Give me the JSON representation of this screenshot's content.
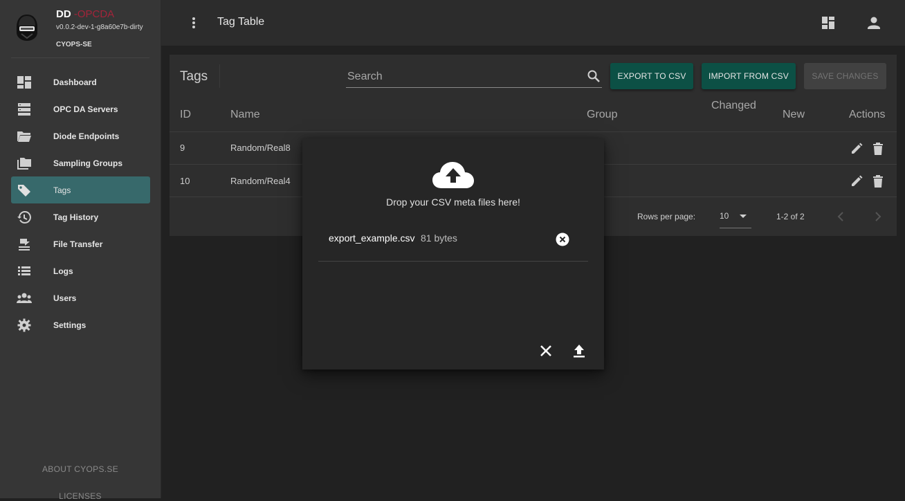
{
  "app": {
    "name": "DD",
    "name_accent": "-OPCDA",
    "version": "v0.0.2-dev-1-g8a60e7b-dirty",
    "org": "CYOPS-SE"
  },
  "sidebar": {
    "items": [
      {
        "label": "Dashboard",
        "icon": "dashboard-icon"
      },
      {
        "label": "OPC DA Servers",
        "icon": "server-icon"
      },
      {
        "label": "Diode Endpoints",
        "icon": "folder-open-icon"
      },
      {
        "label": "Sampling Groups",
        "icon": "folders-icon"
      },
      {
        "label": "Tags",
        "icon": "tag-icon",
        "active": true
      },
      {
        "label": "Tag History",
        "icon": "history-icon"
      },
      {
        "label": "File Transfer",
        "icon": "file-transfer-icon"
      },
      {
        "label": "Logs",
        "icon": "list-icon"
      },
      {
        "label": "Users",
        "icon": "users-icon"
      },
      {
        "label": "Settings",
        "icon": "gear-icon"
      }
    ],
    "footer_about": "ABOUT CYOPS.SE",
    "footer_licenses": "LICENSES"
  },
  "topbar": {
    "title": "Tag Table"
  },
  "panel": {
    "title": "Tags",
    "search_placeholder": "Search",
    "export_label": "EXPORT TO CSV",
    "import_label": "IMPORT FROM CSV",
    "save_label": "SAVE CHANGES",
    "columns": {
      "id": "ID",
      "name": "Name",
      "group": "Group",
      "changed": "Changed",
      "new": "New",
      "actions": "Actions"
    },
    "rows": [
      {
        "id": "9",
        "name": "Random/Real8",
        "group": "..."
      },
      {
        "id": "10",
        "name": "Random/Real4",
        "group": "..."
      }
    ],
    "rows_per_page_label": "Rows per page:",
    "rows_per_page_value": "10",
    "range": "1-2 of 2"
  },
  "dialog": {
    "drop_text": "Drop your CSV meta files here!",
    "file_name": "export_example.csv",
    "file_size": "81 bytes"
  },
  "colors": {
    "accent_teal": "#0c5045",
    "active_nav": "#37696b",
    "brand_red": "#a3243a"
  }
}
